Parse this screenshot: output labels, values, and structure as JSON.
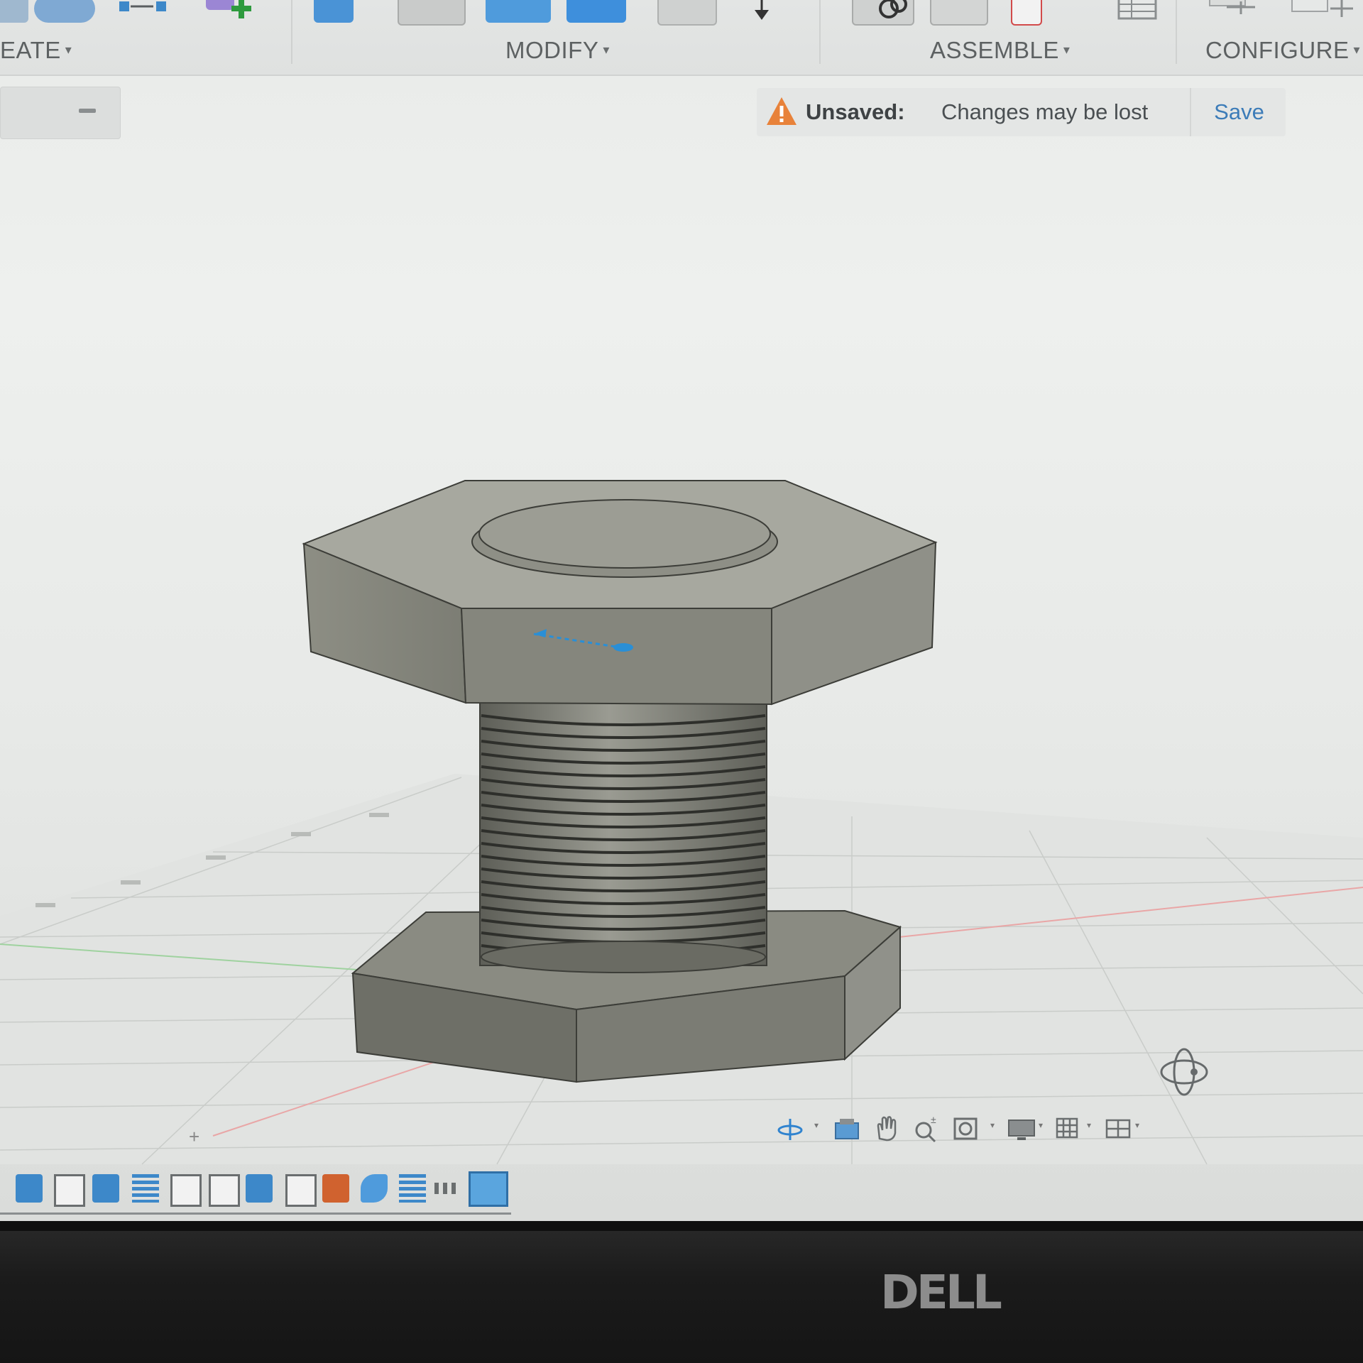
{
  "toolbar": {
    "create_label": "EATE",
    "modify_label": "MODIFY",
    "assemble_label": "ASSEMBLE",
    "configure_label": "CONFIGURE",
    "caret": "▾"
  },
  "banner": {
    "title": "Unsaved:",
    "message": "Changes may be lost",
    "save_label": "Save"
  },
  "timeline": {
    "add_symbol": "+"
  },
  "bezel": {
    "brand": "DELL"
  },
  "colors": {
    "accent": "#3c7cb8",
    "warning": "#e8823a",
    "model": "#7b7c73",
    "grid": "#c8cbc8"
  },
  "icons": {
    "viewcube": "orbit-cube-icon",
    "nav": [
      "orbit-icon",
      "look-at-icon",
      "pan-icon",
      "zoom-icon",
      "fit-icon",
      "display-settings-icon",
      "grid-settings-icon",
      "viewports-icon"
    ]
  }
}
